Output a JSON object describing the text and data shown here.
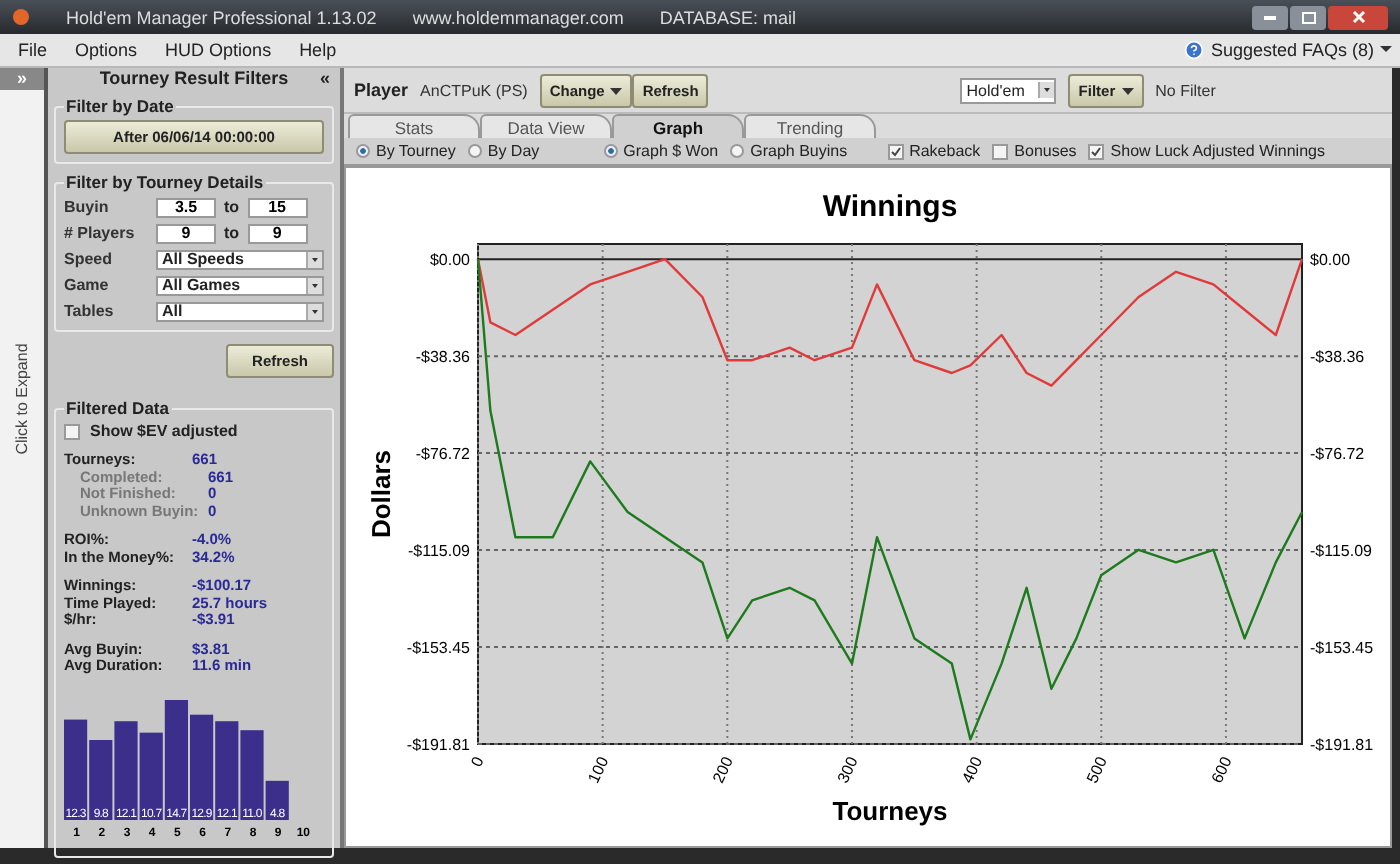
{
  "window": {
    "title": "Hold'em Manager Professional 1.13.02",
    "website": "www.holdemmanager.com",
    "database": "DATABASE: mail"
  },
  "menu": [
    "File",
    "Options",
    "HUD Options",
    "Help"
  ],
  "help_link": "Suggested FAQs (8)",
  "expand_strip": {
    "arrow": "»",
    "label": "Click to Expand"
  },
  "sidebar": {
    "title": "Tourney Result Filters",
    "collapse": "«",
    "date_filter": {
      "title": "Filter by Date",
      "button": "After 06/06/14 00:00:00"
    },
    "details": {
      "title": "Filter by Tourney Details",
      "ranges": [
        {
          "label": "Buyin",
          "from": "3.5",
          "sep": "to",
          "to": "15"
        },
        {
          "label": "# Players",
          "from": "9",
          "sep": "to",
          "to": "9"
        }
      ],
      "selects": [
        {
          "label": "Speed",
          "value": "All Speeds"
        },
        {
          "label": "Game",
          "value": "All Games"
        },
        {
          "label": "Tables",
          "value": "All"
        }
      ]
    },
    "refresh": "Refresh",
    "filtered": {
      "title": "Filtered Data",
      "ev": {
        "label": "Show $EV adjusted",
        "checked": false
      },
      "groups": [
        [
          {
            "kind": "main",
            "label": "Tourneys:",
            "value": "661"
          },
          {
            "kind": "sub",
            "label": "Completed:",
            "value": "661"
          },
          {
            "kind": "sub",
            "label": "Not Finished:",
            "value": "0"
          },
          {
            "kind": "sub",
            "label": "Unknown Buyin:",
            "value": "0"
          }
        ],
        [
          {
            "kind": "main",
            "label": "ROI%:",
            "value": "-4.0%"
          },
          {
            "kind": "main",
            "label": "In the Money%:",
            "value": "34.2%"
          }
        ],
        [
          {
            "kind": "main",
            "label": "Winnings:",
            "value": "-$100.17"
          },
          {
            "kind": "main",
            "label": "Time Played:",
            "value": "25.7 hours"
          },
          {
            "kind": "main",
            "label": "$/hr:",
            "value": "-$3.91"
          }
        ],
        [
          {
            "kind": "main",
            "label": "Avg Buyin:",
            "value": "$3.81"
          },
          {
            "kind": "main",
            "label": "Avg Duration:",
            "value": "11.6 min"
          }
        ]
      ],
      "chart_data": {
        "type": "bar",
        "categories": [
          "1",
          "2",
          "3",
          "4",
          "5",
          "6",
          "7",
          "8",
          "9",
          "10"
        ],
        "series": [
          {
            "color": "#3c2f8c",
            "values": [
              12.3,
              9.8,
              12.1,
              10.7,
              14.7,
              12.9,
              12.1,
              11.0,
              4.8,
              null
            ],
            "value_labels": [
              "12.3",
              "9.8",
              "12.1",
              "10.7",
              "14.7",
              "12.9",
              "12.1",
              "11.0",
              "4.8",
              null
            ]
          }
        ]
      }
    }
  },
  "player_bar": {
    "label": "Player",
    "name": "AnCTPuK (PS)",
    "change": "Change",
    "refresh": "Refresh",
    "game": "Hold'em",
    "filter": "Filter",
    "filter_status": "No Filter"
  },
  "tabs": [
    {
      "label": "Stats",
      "selected": false
    },
    {
      "label": "Data View",
      "selected": false
    },
    {
      "label": "Graph",
      "selected": true
    },
    {
      "label": "Trending",
      "selected": false
    }
  ],
  "radio_groups": [
    [
      {
        "label": "By Tourney",
        "selected": true
      },
      {
        "label": "By Day",
        "selected": false
      }
    ],
    [
      {
        "label": "Graph $ Won",
        "selected": true
      },
      {
        "label": "Graph Buyins",
        "selected": false
      }
    ]
  ],
  "checks": [
    {
      "label": "Rakeback",
      "checked": true
    },
    {
      "label": "Bonuses",
      "checked": false
    },
    {
      "label": "Show Luck Adjusted Winnings",
      "checked": true
    }
  ],
  "chart": {
    "chart_data": {
      "type": "line",
      "title": "Winnings",
      "xlabel": "Tourneys",
      "ylabel": "Dollars",
      "x": [
        0,
        10,
        30,
        60,
        90,
        120,
        150,
        180,
        200,
        220,
        250,
        270,
        300,
        320,
        350,
        380,
        395,
        420,
        440,
        460,
        480,
        500,
        530,
        560,
        590,
        615,
        640,
        661
      ],
      "series": [
        {
          "color": "#e03a3a",
          "values": [
            0,
            -25,
            -30,
            -20,
            -10,
            -5,
            0,
            -15,
            -40,
            -40,
            -35,
            -40,
            -35,
            -10,
            -40,
            -45,
            -42,
            -30,
            -45,
            -50,
            -40,
            -30,
            -15,
            -5,
            -10,
            -20,
            -30,
            0
          ]
        },
        {
          "color": "#1d7a1d",
          "values": [
            0,
            -60,
            -110,
            -110,
            -80,
            -100,
            -110,
            -120,
            -150,
            -135,
            -130,
            -135,
            -160,
            -110,
            -150,
            -160,
            -190,
            -160,
            -130,
            -170,
            -150,
            -125,
            -115,
            -120,
            -115,
            -150,
            -120,
            -100
          ]
        }
      ],
      "xlim": [
        0,
        661
      ],
      "ylim": [
        -191.81,
        6
      ],
      "grid": true,
      "xticks": [
        0,
        100,
        200,
        300,
        400,
        500,
        600
      ],
      "yticks": [
        {
          "value": 0,
          "label": "$0.00"
        },
        {
          "value": -38.36,
          "label": "-$38.36"
        },
        {
          "value": -76.72,
          "label": "-$76.72"
        },
        {
          "value": -115.09,
          "label": "-$115.09"
        },
        {
          "value": -153.45,
          "label": "-$153.45"
        },
        {
          "value": -191.81,
          "label": "-$191.81"
        }
      ]
    }
  }
}
